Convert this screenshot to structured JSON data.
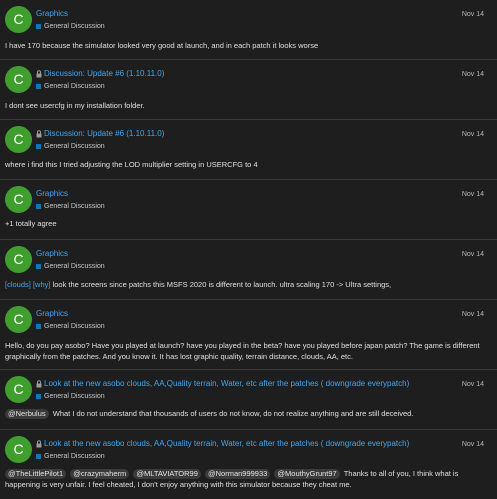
{
  "colors": {
    "background": "#1e1e1e",
    "link": "#3fa9f5",
    "avatar": "#3f9e2e",
    "category": "#0e76bd",
    "divider": "#3a3a3a"
  },
  "icons": {
    "lock": "lock-icon",
    "category": "category-square"
  },
  "posts": [
    {
      "avatar_letter": "C",
      "topic": "Graphics",
      "locked": false,
      "category": "General Discussion",
      "date": "Nov 14",
      "body": "I have 170 because the simulator looked very good at launch, and in each patch it looks worse"
    },
    {
      "avatar_letter": "C",
      "topic": "Discussion: Update #6 (1.10.11.0)",
      "locked": true,
      "category": "General Discussion",
      "date": "Nov 14",
      "body": "I dont see usercfg in my installation folder."
    },
    {
      "avatar_letter": "C",
      "topic": "Discussion: Update #6 (1.10.11.0)",
      "locked": true,
      "category": "General Discussion",
      "date": "Nov 14",
      "body": "where i find this I tried adjusting the LOD multiplier setting in USERCFG to 4"
    },
    {
      "avatar_letter": "C",
      "topic": "Graphics",
      "locked": false,
      "category": "General Discussion",
      "date": "Nov 14",
      "body": "+1 totally agree"
    },
    {
      "avatar_letter": "C",
      "topic": "Graphics",
      "locked": false,
      "category": "General Discussion",
      "date": "Nov 14",
      "tags": [
        "[clouds]",
        "[why]"
      ],
      "body": "look the screens since patchs this MSFS 2020 is different to launch. ultra scaling 170 -> Ultra settings,"
    },
    {
      "avatar_letter": "C",
      "topic": "Graphics",
      "locked": false,
      "category": "General Discussion",
      "date": "Nov 14",
      "body": "Hello, do you pay asobo? Have you played at launch? have you played in the beta? have you played before japan patch? The game is different graphically from the patches. And you know it. It has lost graphic quality, terrain distance, clouds, AA, etc."
    },
    {
      "avatar_letter": "C",
      "topic": "Look at the new asobo clouds, AA,Quality terrain, Water, etc after the patches ( downgrade everypatch)",
      "locked": true,
      "category": "General Discussion",
      "date": "Nov 14",
      "mentions": [
        "@Nerbulus"
      ],
      "body": "What I do not understand that thousands of users do not know, do not realize anything and are still deceived."
    },
    {
      "avatar_letter": "C",
      "topic": "Look at the new asobo clouds, AA,Quality terrain, Water, etc after the patches ( downgrade everypatch)",
      "locked": true,
      "category": "General Discussion",
      "date": "Nov 14",
      "mentions": [
        "@TheLittlePilot1",
        "@crazymaherm",
        "@MLTAVIATOR99",
        "@Norman999933",
        "@MouthyGrunt97"
      ],
      "body": "Thanks to all of you, I think what is happening is very unfair. I feel cheated, I don't enjoy anything with this simulator because they cheat me."
    }
  ]
}
